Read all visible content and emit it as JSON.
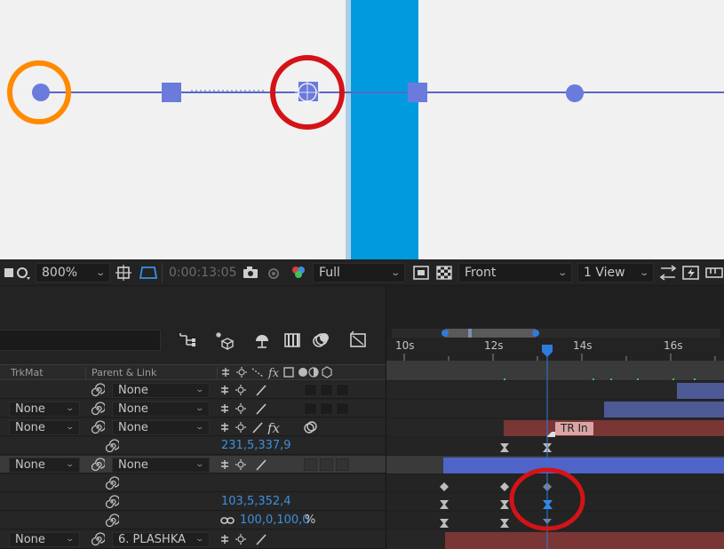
{
  "toolbar": {
    "zoom": "800%",
    "timecode": "0:00:13:05",
    "resolution": "Full",
    "view": "Front",
    "layout": "1 View"
  },
  "columns": {
    "trkmat": "TrkMat",
    "parent_link": "Parent & Link"
  },
  "layers": [
    {
      "type": "layer",
      "trkmat": "",
      "parent": "None"
    },
    {
      "type": "layer",
      "trkmat": "None",
      "parent": "None"
    },
    {
      "type": "layer",
      "trkmat": "None",
      "parent": "None"
    },
    {
      "type": "property",
      "value": "231,5,337,9"
    },
    {
      "type": "layer",
      "trkmat": "None",
      "parent": "None",
      "selected": true
    },
    {
      "type": "property",
      "value": ""
    },
    {
      "type": "property",
      "value": "103,5,352,4"
    },
    {
      "type": "property",
      "value": "100,0,100,0",
      "unit": "%"
    },
    {
      "type": "layer",
      "trkmat": "None",
      "parent": "6. PLASHKA"
    }
  ],
  "ruler": {
    "labels": [
      "10s",
      "12s",
      "14s",
      "16s"
    ],
    "current_time": "13:05"
  },
  "marker": {
    "label": "TR In"
  },
  "colors": {
    "accent_blue": "#2f7bdc",
    "highlight_red": "#d41317",
    "highlight_orange": "#ff8a00",
    "viewer_bar": "#009bdf",
    "path_color": "#6a7bdc",
    "layer_bar_blue": "#4d5a96",
    "layer_bar_red": "#7a3535"
  }
}
